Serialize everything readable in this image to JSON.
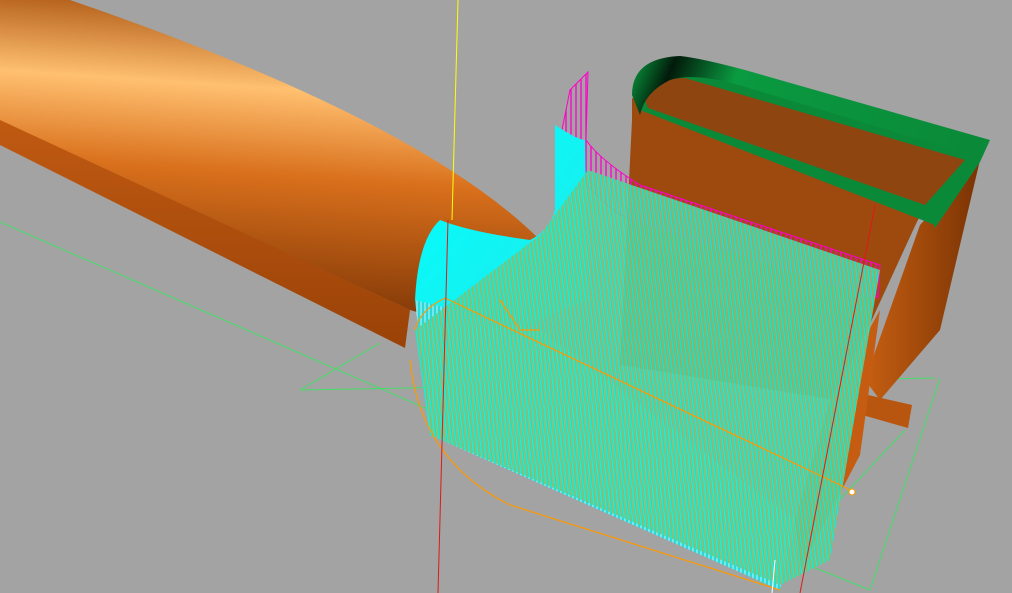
{
  "viewport": {
    "background": "#a3a3a3",
    "scene": "3d-cad-model"
  },
  "colors": {
    "pipe": "#c8661a",
    "pipe_highlight": "#ffc070",
    "pipe_shadow": "#8a3c08",
    "ribbon_top": "#0a9a40",
    "ribbon_dark": "#033a18",
    "block_face": "#9e4a0e",
    "block_side": "#bf5a10",
    "mesh_cyan": "#00ffff",
    "mesh_magenta": "#ff00cc",
    "mesh_orange": "#ff9900",
    "guide_green": "#44dd66",
    "axis_yellow": "#ffff00",
    "axis_red": "#e01818"
  }
}
